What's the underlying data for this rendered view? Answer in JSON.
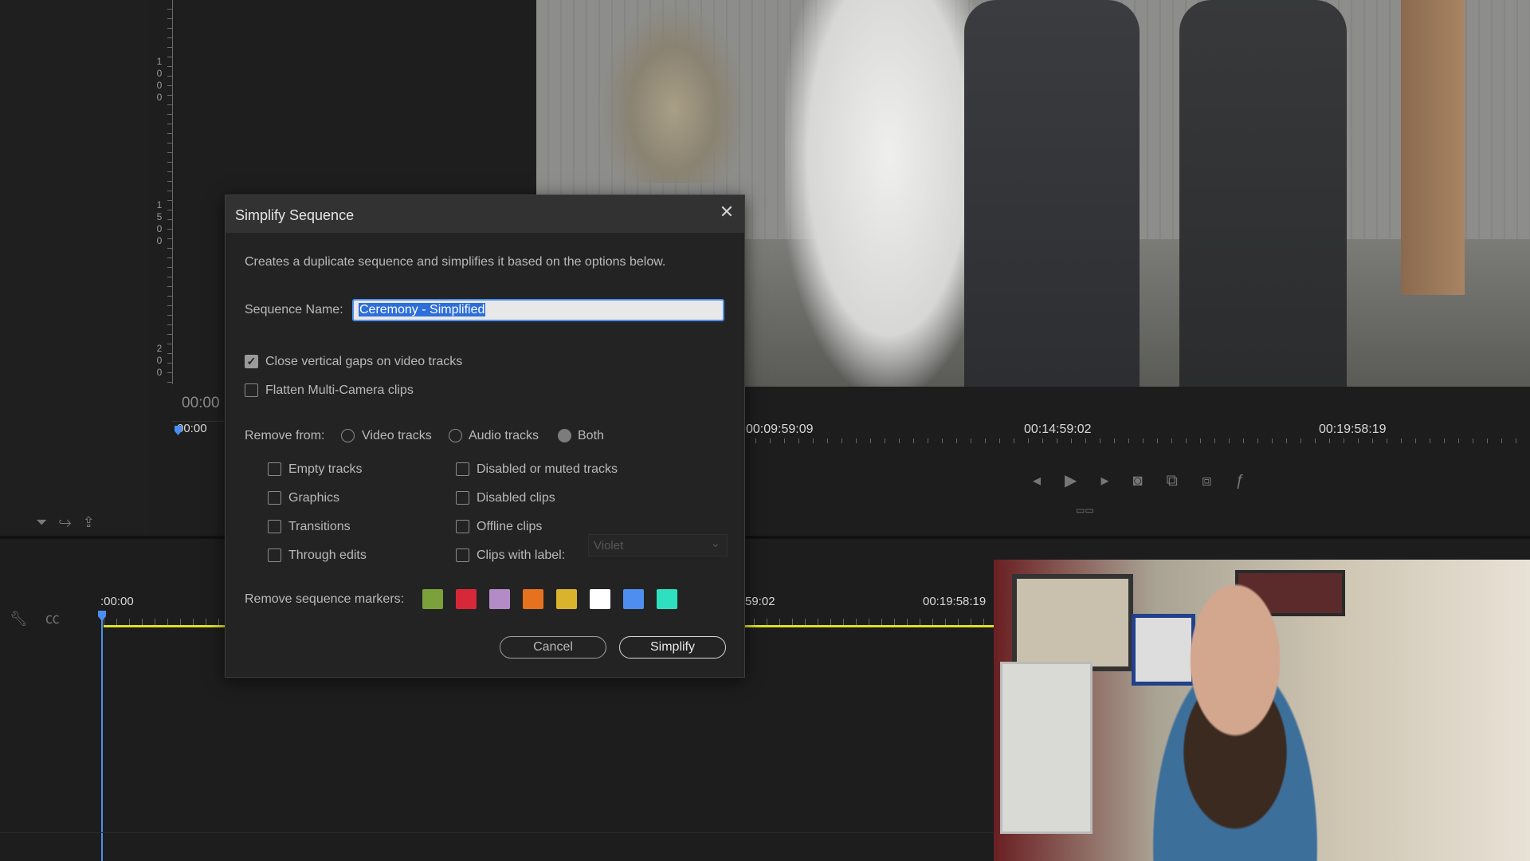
{
  "background": {
    "source_ruler_digits": [
      "1000",
      "1500",
      "200"
    ],
    "source_timecode": "00:00",
    "source_scale_start": "00:00",
    "program_scale_labels": [
      "00:09:59:09",
      "00:14:59:02",
      "00:19:58:19"
    ],
    "timeline_scale_start": ":00:00",
    "timeline_scale_mid": "59:02",
    "timeline_scale_end": "00:19:58:19",
    "timeline_marker_color": "#dede2a",
    "playhead_color": "#4a8ff0"
  },
  "dialog": {
    "title": "Simplify Sequence",
    "close_label": "✕",
    "description": "Creates a duplicate sequence and simplifies it based on the options below.",
    "sequence_name_label": "Sequence Name:",
    "sequence_name_value": "Ceremony - Simplified",
    "options": {
      "close_gaps": {
        "label": "Close vertical gaps on video tracks",
        "checked": true
      },
      "flatten_multicam": {
        "label": "Flatten Multi-Camera clips",
        "checked": false
      }
    },
    "remove_from": {
      "label": "Remove from:",
      "choices": [
        {
          "label": "Video tracks",
          "selected": false
        },
        {
          "label": "Audio tracks",
          "selected": false
        },
        {
          "label": "Both",
          "selected": true
        }
      ]
    },
    "remove_items_left": [
      {
        "label": "Empty tracks",
        "checked": false
      },
      {
        "label": "Graphics",
        "checked": false
      },
      {
        "label": "Transitions",
        "checked": false
      },
      {
        "label": "Through edits",
        "checked": false
      }
    ],
    "remove_items_right": [
      {
        "label": "Disabled or muted tracks",
        "checked": false
      },
      {
        "label": "Disabled clips",
        "checked": false
      },
      {
        "label": "Offline clips",
        "checked": false
      },
      {
        "label": "Clips with label:",
        "checked": false
      }
    ],
    "clip_label_select": "Violet",
    "markers_label": "Remove sequence markers:",
    "marker_colors": [
      "#7aa13a",
      "#d62838",
      "#b38bc7",
      "#e6711f",
      "#d9b32c",
      "#ffffff",
      "#4d8ef0",
      "#2ee0c0"
    ],
    "cancel_label": "Cancel",
    "simplify_label": "Simplify"
  }
}
